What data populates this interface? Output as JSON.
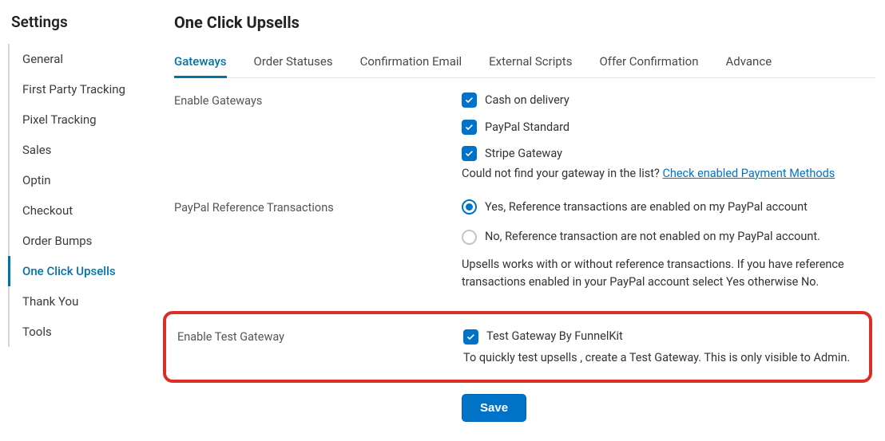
{
  "sidebar": {
    "title": "Settings",
    "items": [
      {
        "label": "General"
      },
      {
        "label": "First Party Tracking"
      },
      {
        "label": "Pixel Tracking"
      },
      {
        "label": "Sales"
      },
      {
        "label": "Optin"
      },
      {
        "label": "Checkout"
      },
      {
        "label": "Order Bumps"
      },
      {
        "label": "One Click Upsells"
      },
      {
        "label": "Thank You"
      },
      {
        "label": "Tools"
      }
    ],
    "active_index": 7
  },
  "page": {
    "title": "One Click Upsells"
  },
  "tabs": {
    "items": [
      {
        "label": "Gateways"
      },
      {
        "label": "Order Statuses"
      },
      {
        "label": "Confirmation Email"
      },
      {
        "label": "External Scripts"
      },
      {
        "label": "Offer Confirmation"
      },
      {
        "label": "Advance"
      }
    ],
    "active_index": 0
  },
  "sections": {
    "enable_gateways": {
      "label": "Enable Gateways",
      "options": [
        {
          "label": "Cash on delivery"
        },
        {
          "label": "PayPal Standard"
        },
        {
          "label": "Stripe Gateway"
        }
      ],
      "hint_prefix": "Could not find your gateway in the list? ",
      "hint_link": "Check enabled Payment Methods"
    },
    "paypal_ref": {
      "label": "PayPal Reference Transactions",
      "options": [
        {
          "label": "Yes, Reference transactions are enabled on my PayPal account"
        },
        {
          "label": "No, Reference transaction are not enabled on my PayPal account."
        }
      ],
      "selected_index": 0,
      "helper": "Upsells works with or without reference transactions. If you have reference transactions enabled in your PayPal account select Yes otherwise No."
    },
    "test_gateway": {
      "label": "Enable Test Gateway",
      "option_label": "Test Gateway By FunnelKit",
      "helper": "To quickly test upsells , create a Test Gateway. This is only visible to Admin."
    }
  },
  "buttons": {
    "save": "Save"
  }
}
